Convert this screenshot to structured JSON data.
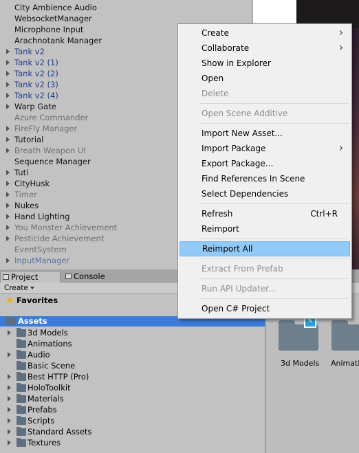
{
  "hierarchy": {
    "items": [
      {
        "label": "City Ambience Audio",
        "type": "normal",
        "arrow": false
      },
      {
        "label": "WebsocketManager",
        "type": "normal",
        "arrow": false
      },
      {
        "label": "Microphone Input",
        "type": "normal",
        "arrow": false
      },
      {
        "label": "Arachnotank Manager",
        "type": "normal",
        "arrow": false
      },
      {
        "label": "Tank v2",
        "type": "prefab",
        "arrow": true
      },
      {
        "label": "Tank v2 (1)",
        "type": "prefab",
        "arrow": true
      },
      {
        "label": "Tank v2 (2)",
        "type": "prefab",
        "arrow": true
      },
      {
        "label": "Tank v2 (3)",
        "type": "prefab",
        "arrow": true
      },
      {
        "label": "Tank v2 (4)",
        "type": "prefab",
        "arrow": true
      },
      {
        "label": "Warp Gate",
        "type": "normal",
        "arrow": true
      },
      {
        "label": "Azure Commander",
        "type": "disabled",
        "arrow": false
      },
      {
        "label": "FireFly Manager",
        "type": "disabled",
        "arrow": true
      },
      {
        "label": "Tutorial",
        "type": "normal",
        "arrow": true
      },
      {
        "label": "Breath Weapon UI",
        "type": "disabled",
        "arrow": true
      },
      {
        "label": "Sequence Manager",
        "type": "normal",
        "arrow": false
      },
      {
        "label": "Tuti",
        "type": "normal",
        "arrow": true
      },
      {
        "label": "CityHusk",
        "type": "normal",
        "arrow": true
      },
      {
        "label": "Timer",
        "type": "disabled",
        "arrow": true
      },
      {
        "label": "Nukes",
        "type": "normal",
        "arrow": true
      },
      {
        "label": "Hand Lighting",
        "type": "normal",
        "arrow": true
      },
      {
        "label": "You Monster Achievement",
        "type": "disabled",
        "arrow": true
      },
      {
        "label": "Pesticide Achievement",
        "type": "disabled",
        "arrow": true
      },
      {
        "label": "EventSystem",
        "type": "disabled",
        "arrow": false
      },
      {
        "label": "InputManager",
        "type": "prefab-disabled",
        "arrow": true
      }
    ]
  },
  "tabs": {
    "project": "Project",
    "console": "Console"
  },
  "toolbar": {
    "create_label": "Create"
  },
  "project": {
    "favorites_label": "Favorites",
    "assets_label": "Assets",
    "folders": [
      {
        "label": "3d Models",
        "arrow": true
      },
      {
        "label": "Animations",
        "arrow": false
      },
      {
        "label": "Audio",
        "arrow": true
      },
      {
        "label": "Basic Scene",
        "arrow": false
      },
      {
        "label": "Best HTTP (Pro)",
        "arrow": true
      },
      {
        "label": "HoloToolkit",
        "arrow": true
      },
      {
        "label": "Materials",
        "arrow": true
      },
      {
        "label": "Prefabs",
        "arrow": true
      },
      {
        "label": "Scripts",
        "arrow": true
      },
      {
        "label": "Standard Assets",
        "arrow": true
      },
      {
        "label": "Textures",
        "arrow": true
      }
    ],
    "grid": [
      {
        "label": "3d Models"
      },
      {
        "label": "Animatio"
      }
    ]
  },
  "context_menu": {
    "items": [
      {
        "label": "Create",
        "disabled": false,
        "submenu": true
      },
      {
        "label": "Collaborate",
        "disabled": false,
        "submenu": true
      },
      {
        "label": "Show in Explorer",
        "disabled": false
      },
      {
        "label": "Open",
        "disabled": false
      },
      {
        "label": "Delete",
        "disabled": true
      },
      {
        "separator": true
      },
      {
        "label": "Open Scene Additive",
        "disabled": true
      },
      {
        "separator": true
      },
      {
        "label": "Import New Asset...",
        "disabled": false
      },
      {
        "label": "Import Package",
        "disabled": false,
        "submenu": true
      },
      {
        "label": "Export Package...",
        "disabled": false
      },
      {
        "label": "Find References In Scene",
        "disabled": false
      },
      {
        "label": "Select Dependencies",
        "disabled": false
      },
      {
        "separator": true
      },
      {
        "label": "Refresh",
        "disabled": false,
        "shortcut": "Ctrl+R"
      },
      {
        "label": "Reimport",
        "disabled": false
      },
      {
        "separator": true
      },
      {
        "label": "Reimport All",
        "disabled": false,
        "highlighted": true
      },
      {
        "separator": true
      },
      {
        "label": "Extract From Prefab",
        "disabled": true
      },
      {
        "separator": true
      },
      {
        "label": "Run API Updater...",
        "disabled": true
      },
      {
        "separator": true
      },
      {
        "label": "Open C# Project",
        "disabled": false
      }
    ]
  },
  "colors": {
    "selection": "#3d7bd8",
    "menu_highlight": "#91c9f7",
    "prefab_text": "#1f3b8f"
  }
}
